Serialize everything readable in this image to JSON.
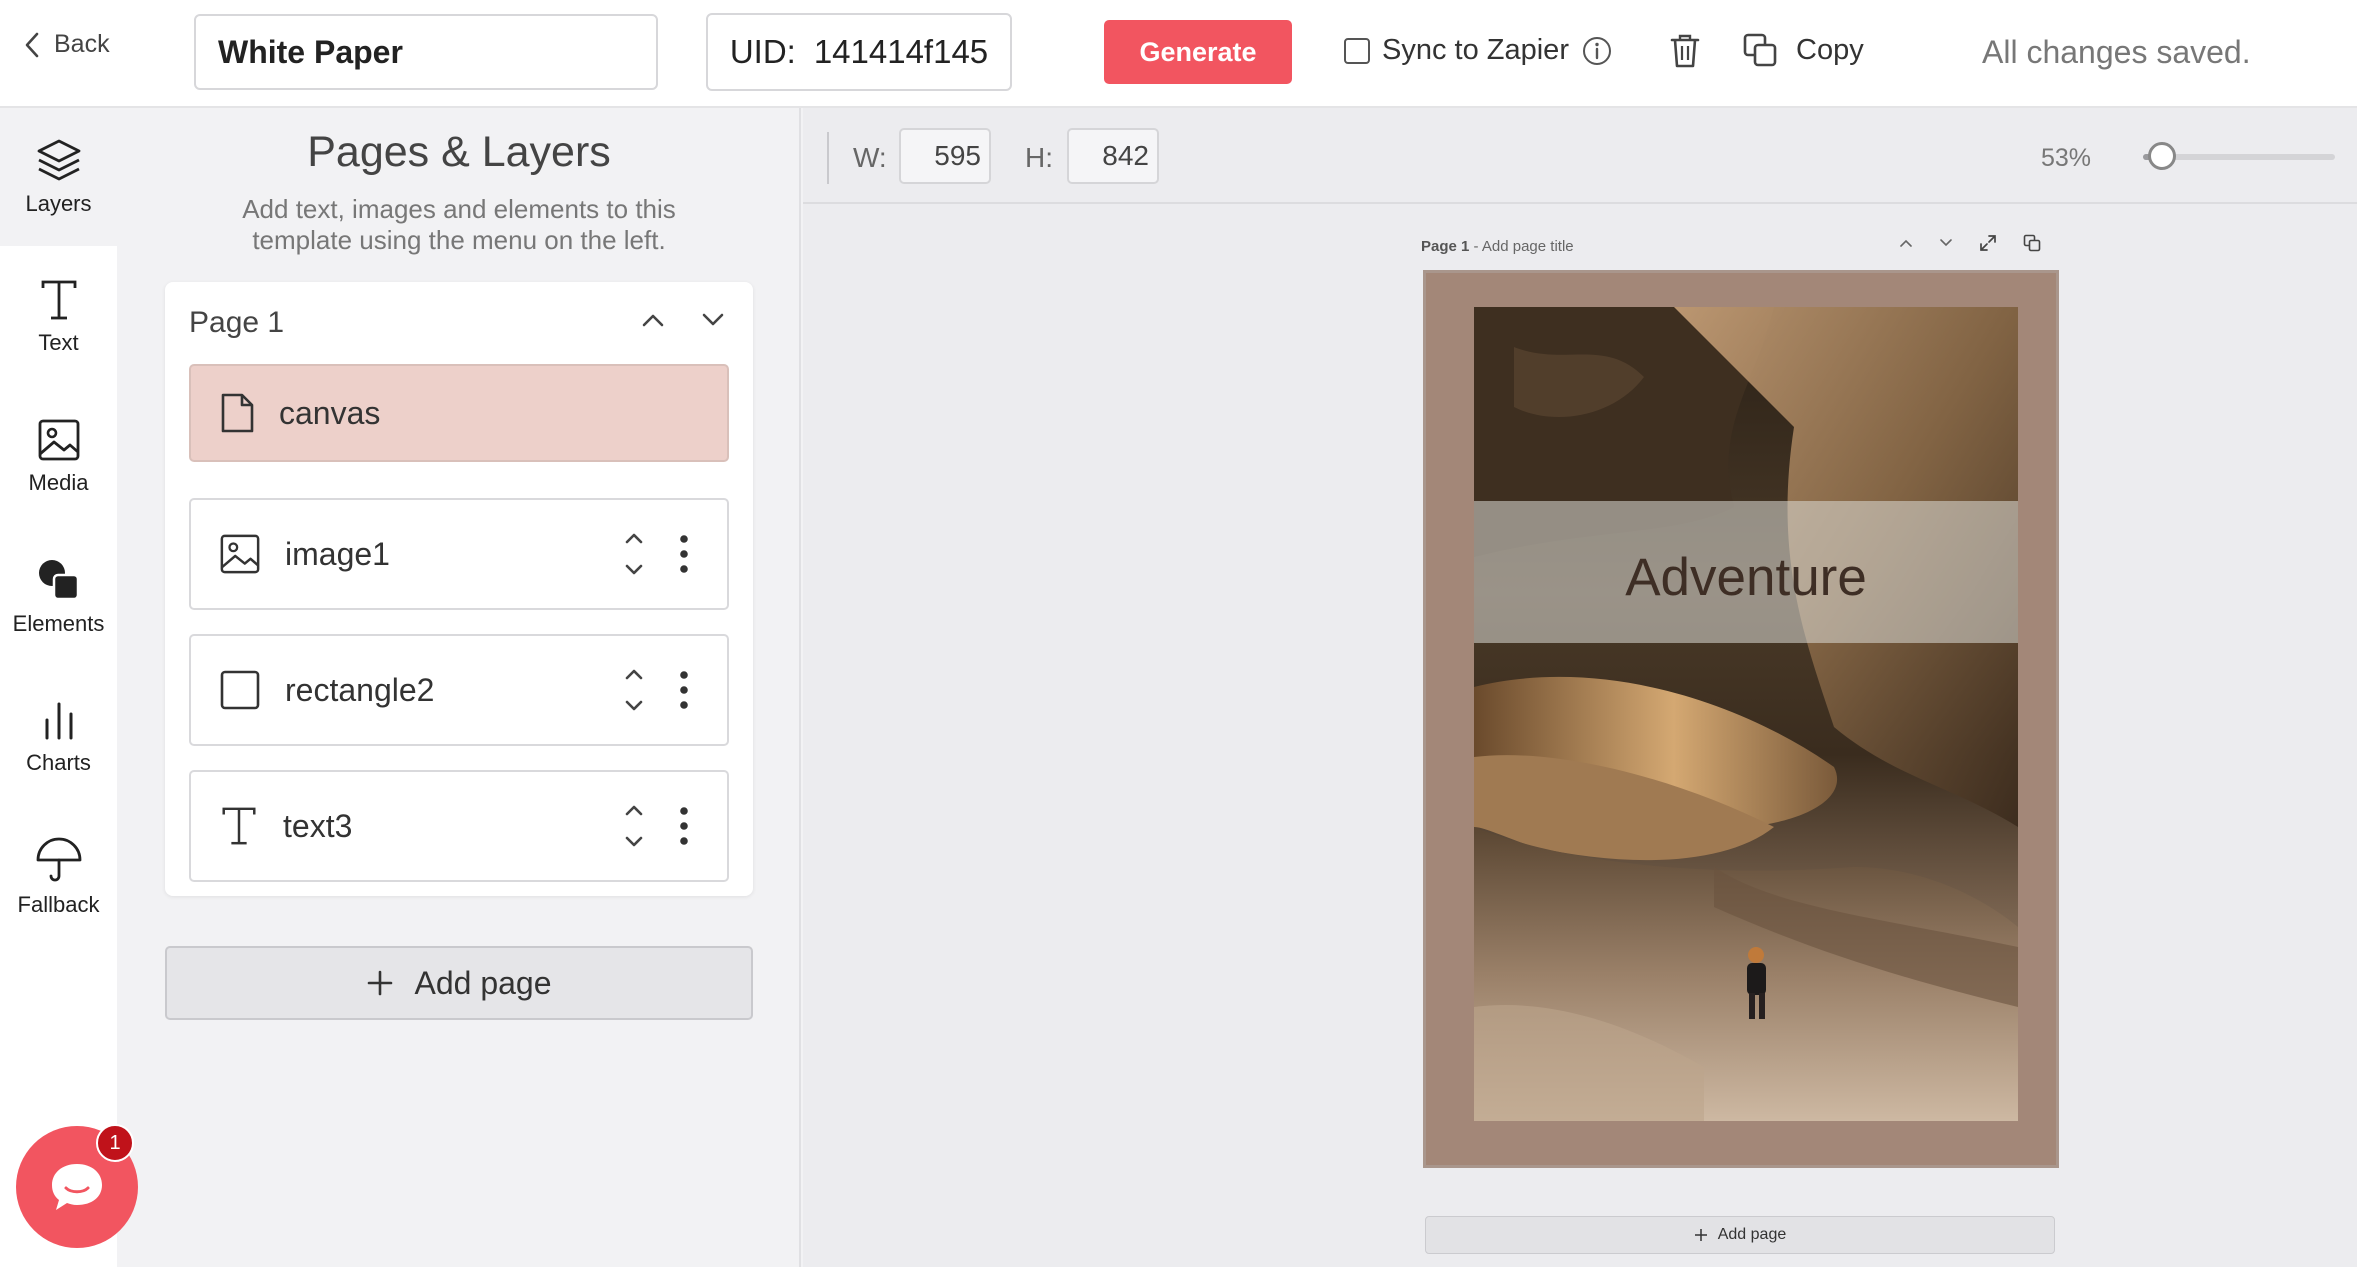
{
  "topbar": {
    "back_label": "Back",
    "template_name": "White Paper",
    "uid_label": "UID:",
    "uid_value": "141414f145",
    "generate_label": "Generate",
    "sync_label": "Sync to Zapier",
    "copy_label": "Copy",
    "status": "All changes saved."
  },
  "rail": {
    "items": [
      {
        "label": "Layers",
        "icon": "layers-icon",
        "active": true
      },
      {
        "label": "Text",
        "icon": "text-icon"
      },
      {
        "label": "Media",
        "icon": "image-icon"
      },
      {
        "label": "Elements",
        "icon": "shapes-icon"
      },
      {
        "label": "Charts",
        "icon": "bar-chart-icon"
      },
      {
        "label": "Fallback",
        "icon": "umbrella-icon"
      }
    ]
  },
  "panel": {
    "title": "Pages & Layers",
    "description": "Add text, images and elements to this template using the menu on the left.",
    "page_name": "Page 1",
    "layers": [
      {
        "name": "canvas",
        "icon": "file-icon",
        "selected": true
      },
      {
        "name": "image1",
        "icon": "image-icon"
      },
      {
        "name": "rectangle2",
        "icon": "square-icon"
      },
      {
        "name": "text3",
        "icon": "text-icon"
      }
    ],
    "add_page_label": "Add page"
  },
  "canvas": {
    "width_label": "W:",
    "width_value": "595",
    "height_label": "H:",
    "height_value": "842",
    "zoom_label": "53%",
    "zoom_fraction": 0.1,
    "page_label_bold": "Page 1",
    "page_label_rest": " - Add page title",
    "page_text": "Adventure",
    "add_page_label": "Add page"
  },
  "chat": {
    "badge_count": "1"
  },
  "colors": {
    "accent": "#f25560",
    "selected_layer": "#edd0ca",
    "page_bg": "#a38778"
  }
}
